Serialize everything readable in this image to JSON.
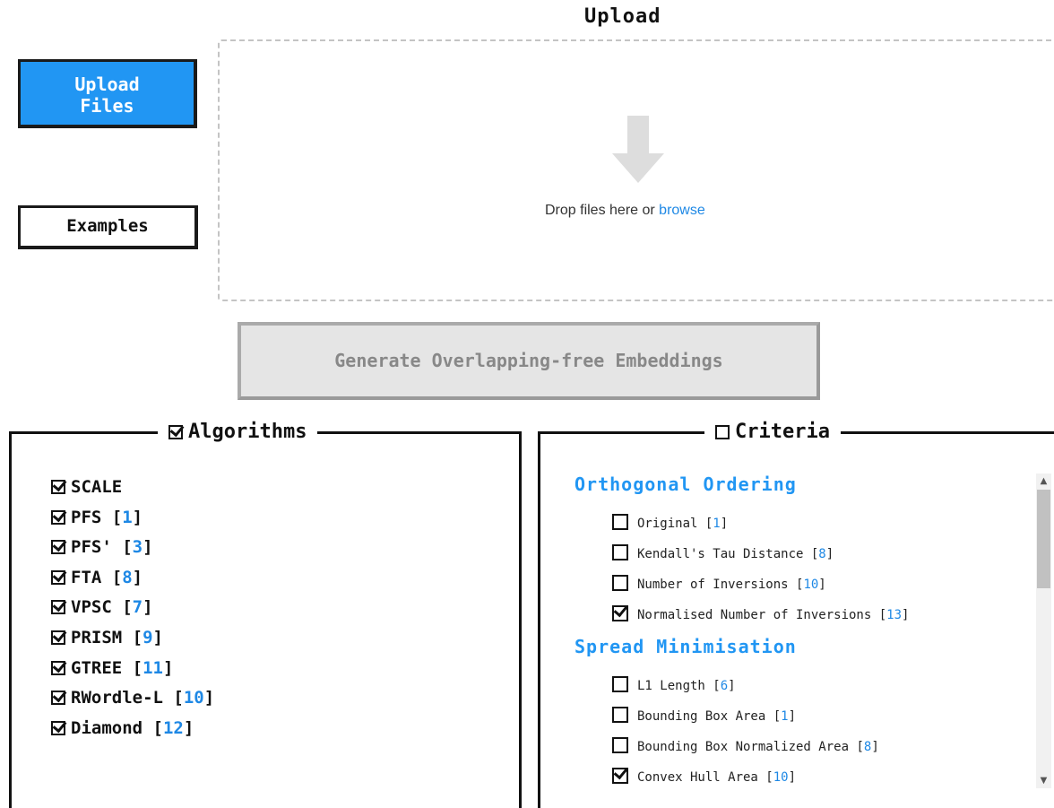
{
  "upload": {
    "title": "Upload",
    "upload_button": "Upload\nFiles",
    "examples_button": "Examples",
    "drop_text": "Drop files here or",
    "browse_link": "browse",
    "generate_button": "Generate Overlapping-free Embeddings"
  },
  "algorithms": {
    "legend": "Algorithms",
    "checked": true,
    "items": [
      {
        "name": "SCALE",
        "ref": "",
        "checked": true
      },
      {
        "name": "PFS",
        "ref": "1",
        "checked": true
      },
      {
        "name": "PFS'",
        "ref": "3",
        "checked": true
      },
      {
        "name": "FTA",
        "ref": "8",
        "checked": true
      },
      {
        "name": "VPSC",
        "ref": "7",
        "checked": true
      },
      {
        "name": "PRISM",
        "ref": "9",
        "checked": true
      },
      {
        "name": "GTREE",
        "ref": "11",
        "checked": true
      },
      {
        "name": "RWordle-L",
        "ref": "10",
        "checked": true
      },
      {
        "name": "Diamond",
        "ref": "12",
        "checked": true
      }
    ]
  },
  "criteria": {
    "legend": "Criteria",
    "checked": false,
    "sections": [
      {
        "title": "Orthogonal Ordering",
        "items": [
          {
            "name": "Original",
            "ref": "1",
            "checked": false
          },
          {
            "name": "Kendall's Tau Distance",
            "ref": "8",
            "checked": false
          },
          {
            "name": "Number of Inversions",
            "ref": "10",
            "checked": false
          },
          {
            "name": "Normalised Number of Inversions",
            "ref": "13",
            "checked": true
          }
        ]
      },
      {
        "title": "Spread Minimisation",
        "items": [
          {
            "name": "L1 Length",
            "ref": "6",
            "checked": false
          },
          {
            "name": "Bounding Box Area",
            "ref": "1",
            "checked": false
          },
          {
            "name": "Bounding Box Normalized Area",
            "ref": "8",
            "checked": false
          },
          {
            "name": "Convex Hull Area",
            "ref": "10",
            "checked": true
          }
        ]
      }
    ]
  },
  "colors": {
    "accent": "#2196f3",
    "link": "#1e88e5"
  }
}
